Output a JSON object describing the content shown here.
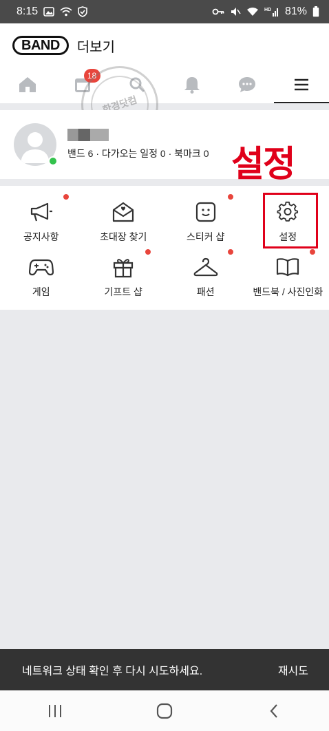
{
  "status_bar": {
    "time": "8:15",
    "battery": "81%"
  },
  "header": {
    "logo": "BAND",
    "title": "더보기"
  },
  "tabs": {
    "calendar_badge": "18"
  },
  "profile": {
    "stats": "밴드 6 · 다가오는 일정 0 · 북마크 0"
  },
  "annotation": {
    "label": "설정",
    "color": "#e0001a"
  },
  "watermark": {
    "text": "한경닷컴"
  },
  "menu": {
    "items": [
      {
        "label": "공지사항",
        "icon": "megaphone-icon",
        "dot": true
      },
      {
        "label": "초대장 찾기",
        "icon": "envelope-icon",
        "dot": false
      },
      {
        "label": "스티커 샵",
        "icon": "sticker-icon",
        "dot": true
      },
      {
        "label": "설정",
        "icon": "gear-icon",
        "dot": false
      },
      {
        "label": "게임",
        "icon": "gamepad-icon",
        "dot": false
      },
      {
        "label": "기프트 샵",
        "icon": "gift-icon",
        "dot": true
      },
      {
        "label": "패션",
        "icon": "hanger-icon",
        "dot": true
      },
      {
        "label": "밴드북 / 사진인화",
        "icon": "book-icon",
        "dot": true
      }
    ]
  },
  "snackbar": {
    "message": "네트워크 상태 확인 후 다시 시도하세요.",
    "action": "재시도"
  },
  "colors": {
    "badge": "#e8453c",
    "online": "#33c24d",
    "snackbar_bg": "#333333"
  }
}
